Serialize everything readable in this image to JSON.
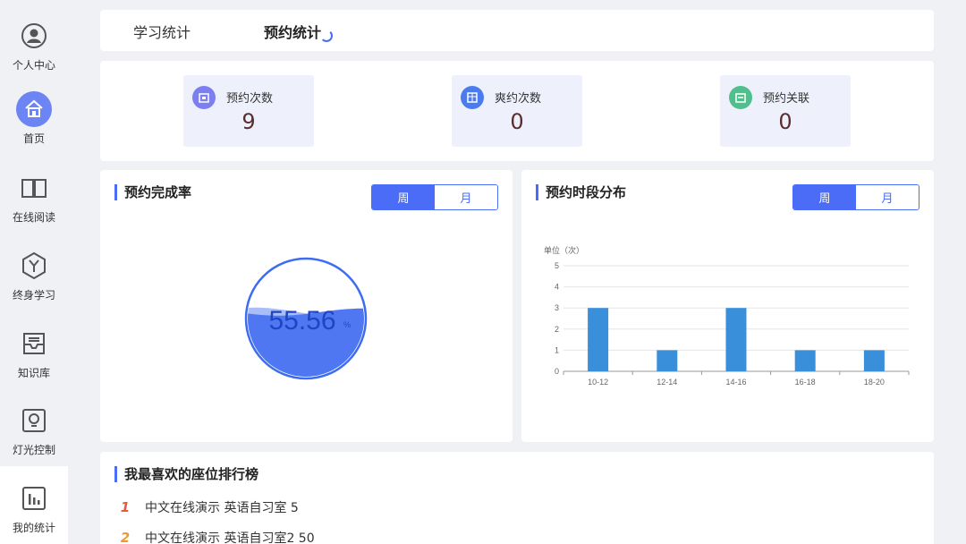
{
  "sidebar": {
    "items": [
      {
        "label": "个人中心",
        "icon": "user-icon"
      },
      {
        "label": "首页",
        "icon": "home-icon"
      },
      {
        "label": "在线阅读",
        "icon": "book-icon"
      },
      {
        "label": "终身学习",
        "icon": "learning-icon"
      },
      {
        "label": "知识库",
        "icon": "knowledge-box-icon"
      },
      {
        "label": "灯光控制",
        "icon": "bulb-icon"
      },
      {
        "label": "我的统计",
        "icon": "bar-chart-icon"
      }
    ]
  },
  "tabs": [
    {
      "label": "学习统计"
    },
    {
      "label": "预约统计"
    }
  ],
  "stats": [
    {
      "title": "预约次数",
      "value": "9",
      "icon": "calendar-icon",
      "color": "#7b7ff0"
    },
    {
      "title": "爽约次数",
      "value": "0",
      "icon": "grid-calendar-icon",
      "color": "#4a7cf0"
    },
    {
      "title": "预约关联",
      "value": "0",
      "icon": "link-calendar-icon",
      "color": "#4fc08d"
    }
  ],
  "rate_panel": {
    "title": "预约完成率",
    "toggle": {
      "week": "周",
      "month": "月"
    },
    "value": "55.56",
    "unit": "%",
    "fill_fraction": 0.5556
  },
  "dist_panel": {
    "title": "预约时段分布",
    "toggle": {
      "week": "周",
      "month": "月"
    }
  },
  "chart_data": {
    "type": "bar",
    "ylabel": "单位（次）",
    "categories": [
      "10-12",
      "12-14",
      "14-16",
      "16-18",
      "18-20"
    ],
    "values": [
      3,
      1,
      3,
      1,
      1
    ],
    "ylim": [
      0,
      5
    ],
    "yticks": [
      "0",
      "1",
      "2",
      "3",
      "4",
      "5"
    ],
    "color": "#3a8fdb",
    "grid": true
  },
  "ranking": {
    "title": "我最喜欢的座位排行榜",
    "items": [
      {
        "rank": "1",
        "text": "中文在线演示 英语自习室 5"
      },
      {
        "rank": "2",
        "text": "中文在线演示 英语自习室2 50"
      }
    ]
  }
}
